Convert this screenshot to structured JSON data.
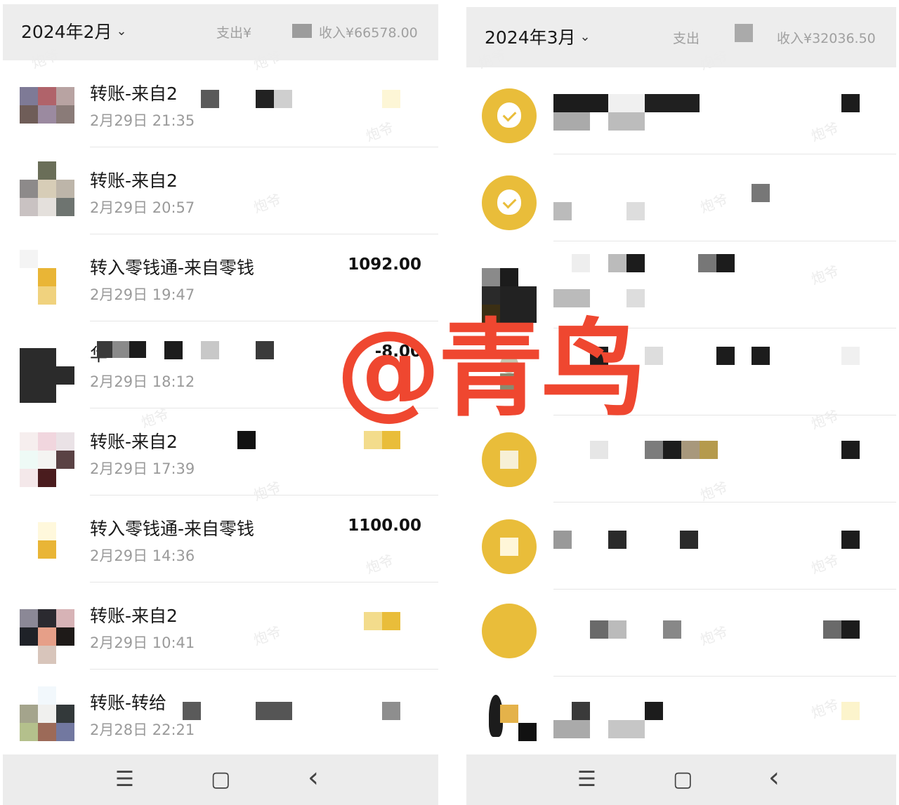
{
  "left": {
    "header": {
      "month": "2024年2月",
      "expense_label": "支出¥",
      "income_label": "收入¥66578.00"
    },
    "rows": [
      {
        "title": "转账-来自2",
        "time": "2月29日 21:35",
        "amount": ""
      },
      {
        "title": "转账-来自2",
        "time": "2月29日 20:57",
        "amount": ""
      },
      {
        "title": "转入零钱通-来自零钱",
        "time": "2月29日 19:47",
        "amount": "1092.00"
      },
      {
        "title": "华",
        "time": "2月29日 18:12",
        "amount": "-8.00"
      },
      {
        "title": "转账-来自2",
        "time": "2月29日 17:39",
        "amount": ""
      },
      {
        "title": "转入零钱通-来自零钱",
        "time": "2月29日 14:36",
        "amount": "1100.00"
      },
      {
        "title": "转账-来自2",
        "time": "2月29日 10:41",
        "amount": ""
      },
      {
        "title": "转账-转给",
        "time": "2月28日 22:21",
        "amount": ""
      }
    ],
    "nav": {
      "menu": "☰",
      "home": "▢",
      "back": "‹"
    }
  },
  "right": {
    "header": {
      "month": "2024年3月",
      "expense_label": "支出",
      "income_label": "收入¥32036.50"
    },
    "nav": {
      "menu": "☰",
      "home": "▢",
      "back": "‹"
    }
  },
  "overlay": {
    "text": "@青鸟"
  },
  "watermark_text": "炮爷",
  "colors": {
    "accent_gold": "#e9bd3a",
    "overlay_red": "#ef4730"
  }
}
